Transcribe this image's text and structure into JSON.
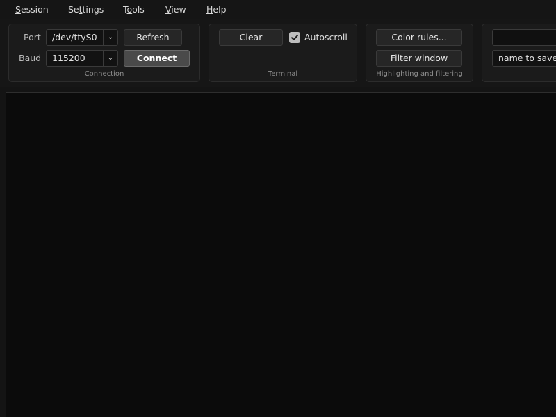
{
  "menu": {
    "items": [
      {
        "pre": "",
        "u": "S",
        "post": "ession"
      },
      {
        "pre": "Se",
        "u": "t",
        "post": "tings"
      },
      {
        "pre": "T",
        "u": "o",
        "post": "ols"
      },
      {
        "pre": "",
        "u": "V",
        "post": "iew"
      },
      {
        "pre": "",
        "u": "H",
        "post": "elp"
      }
    ]
  },
  "connection": {
    "caption": "Connection",
    "port_label": "Port",
    "port_value": "/dev/ttyS0",
    "baud_label": "Baud",
    "baud_value": "115200",
    "refresh_label": "Refresh",
    "connect_label": "Connect"
  },
  "terminal_group": {
    "caption": "Terminal",
    "clear_label": "Clear",
    "autoscroll_label": "Autoscroll",
    "autoscroll_checked": true
  },
  "highlighting": {
    "caption": "Highlighting and filtering",
    "color_rules_label": "Color rules...",
    "filter_window_label": "Filter window"
  },
  "save": {
    "input_value": "",
    "name_placeholder": "name to save"
  },
  "icons": {
    "dropdown": "chevron-down-icon",
    "check": "checkmark-icon"
  },
  "colors": {
    "background": "#141414",
    "terminal_bg": "#0b0b0b",
    "primary_button": "#4a4a4a"
  }
}
